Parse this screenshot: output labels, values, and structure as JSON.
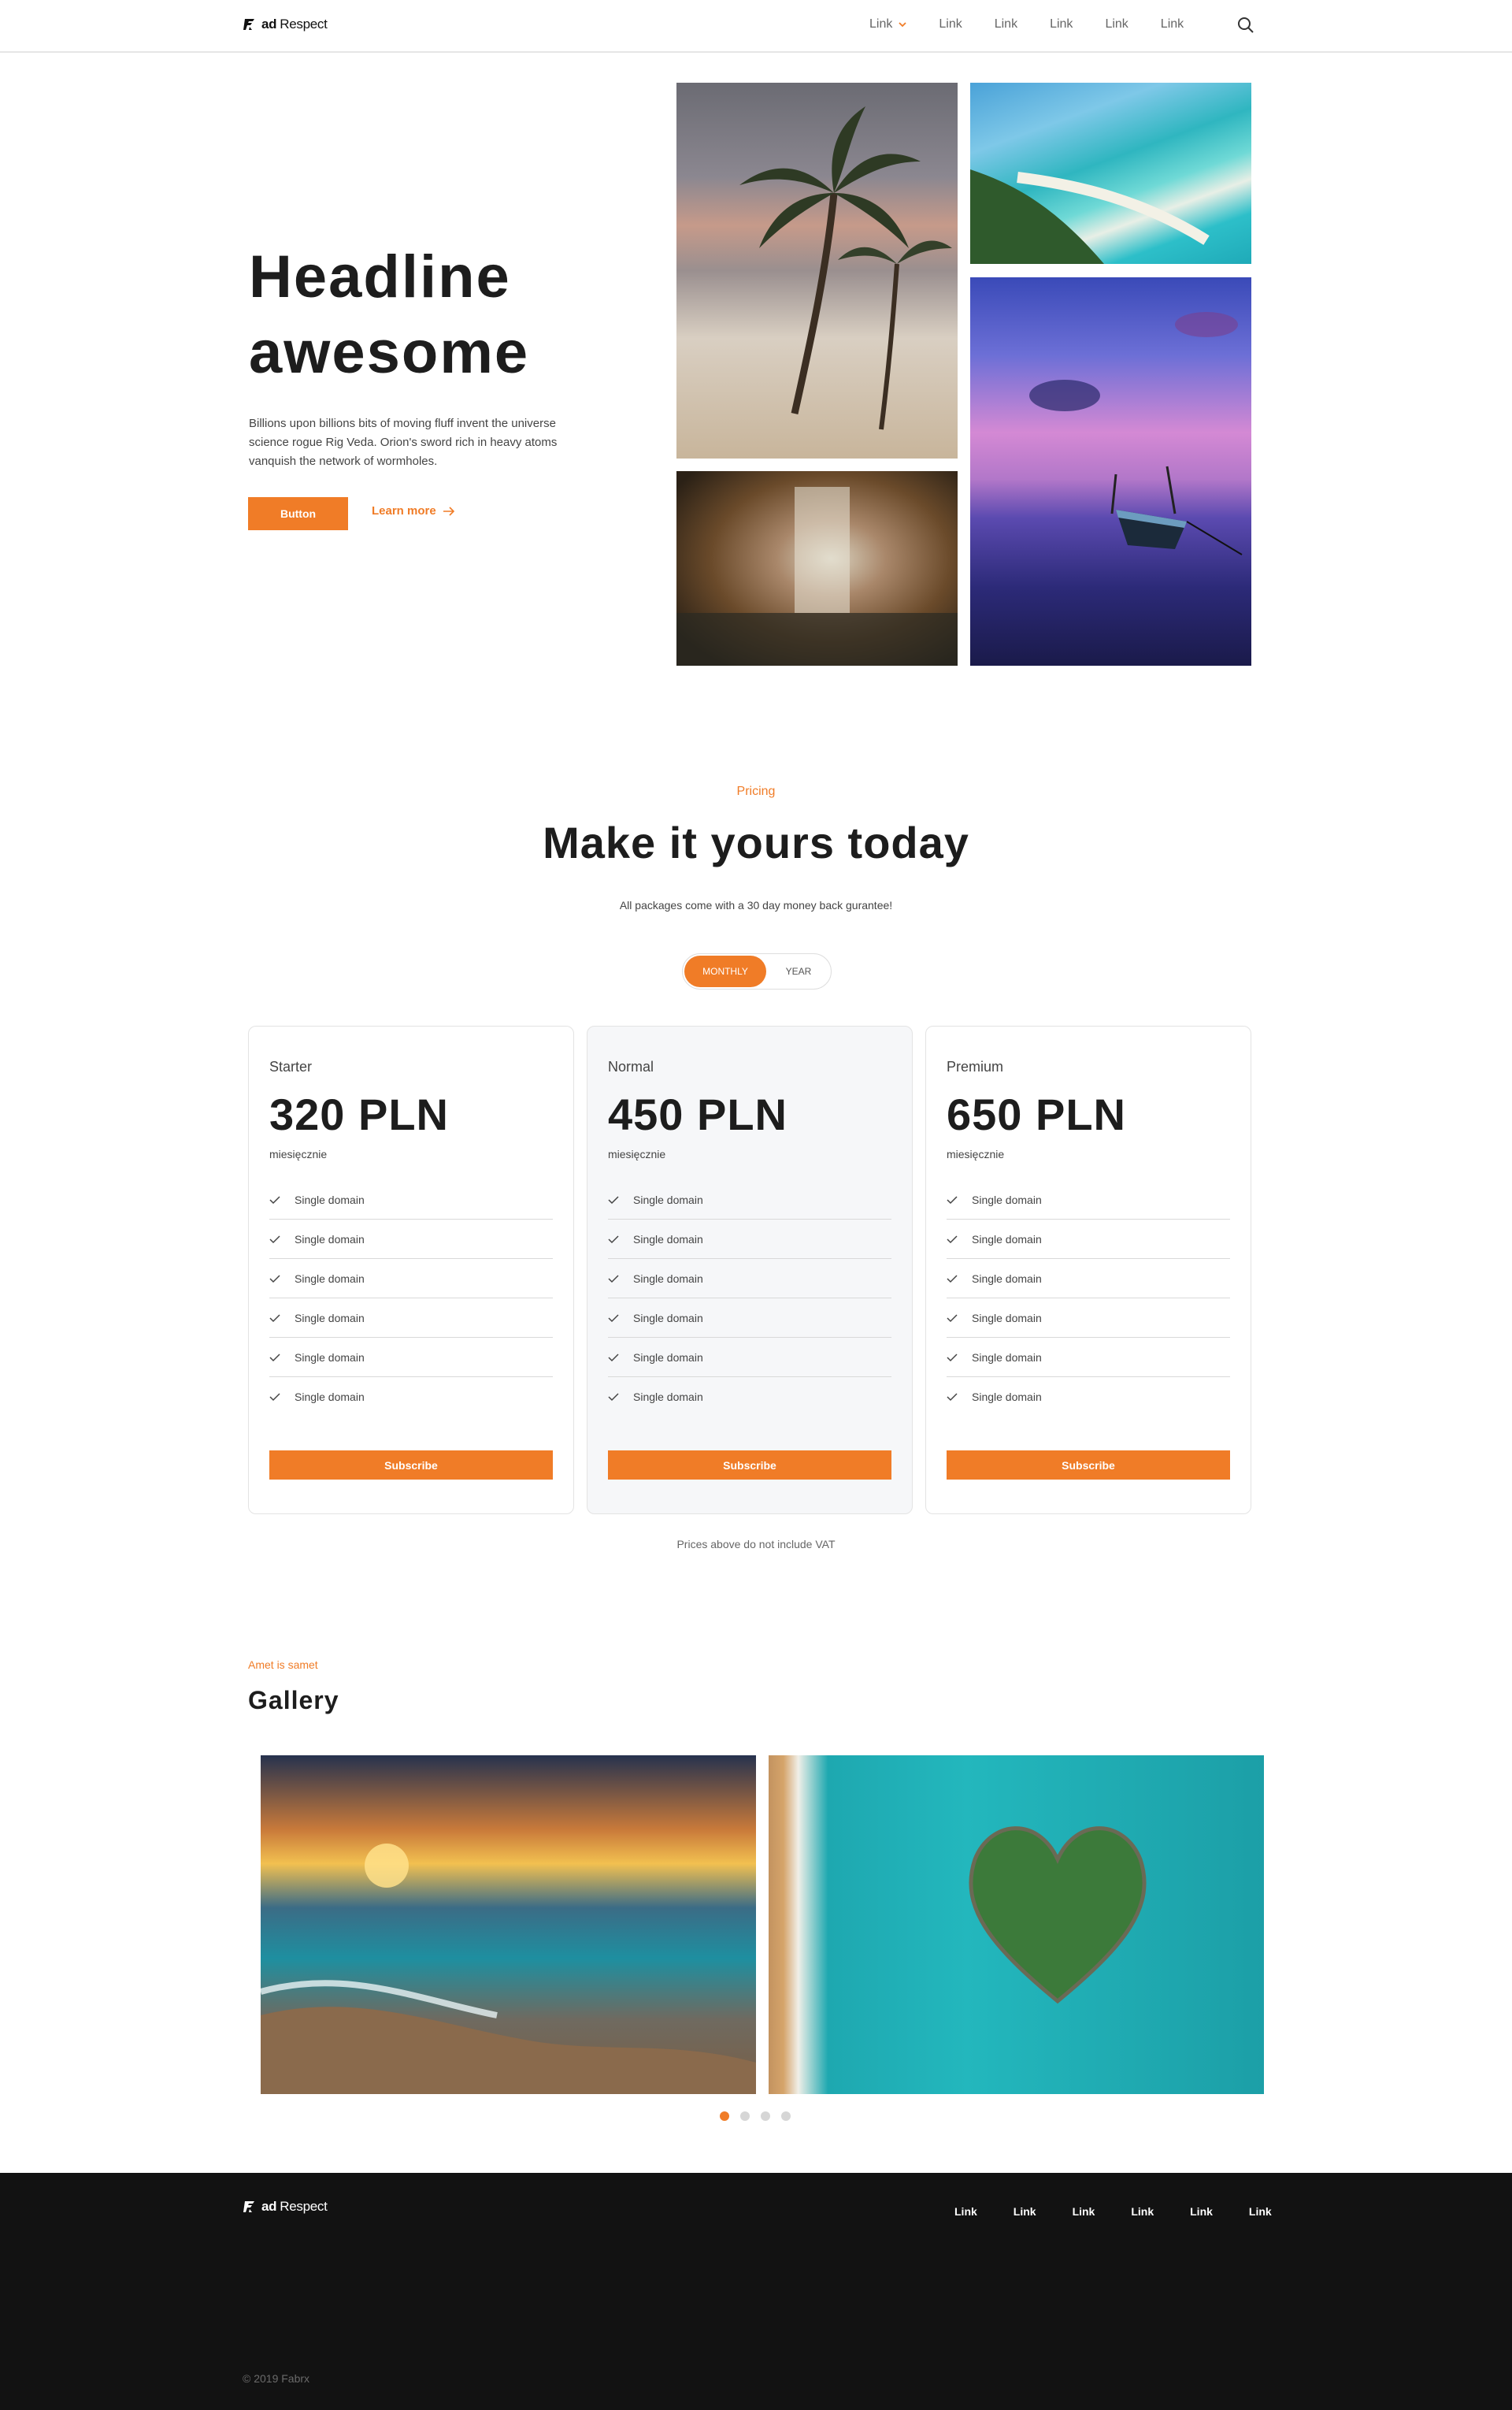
{
  "brand": {
    "logo_bold": "ad",
    "logo_regular": "Respect"
  },
  "nav": {
    "links": [
      "Link",
      "Link",
      "Link",
      "Link",
      "Link",
      "Link"
    ]
  },
  "hero": {
    "title": "Headline awesome",
    "text": "Billions upon billions bits of moving fluff invent the universe science rogue Rig Veda. Orion's sword rich in heavy atoms vanquish the network of wormholes.",
    "button": "Button",
    "learn_more": "Learn more"
  },
  "pricing": {
    "eyebrow": "Pricing",
    "title": "Make it yours today",
    "subtitle": "All packages come with a 30 day money back gurantee!",
    "toggle": {
      "monthly": "MONTHLY",
      "year": "YEAR",
      "selected": "MONTHLY"
    },
    "plans": [
      {
        "name": "Starter",
        "price": "320 PLN",
        "period": "miesięcznie",
        "features": [
          "Single domain",
          "Single domain",
          "Single domain",
          "Single domain",
          "Single domain",
          "Single domain"
        ],
        "cta": "Subscribe"
      },
      {
        "name": "Normal",
        "price": "450 PLN",
        "period": "miesięcznie",
        "features": [
          "Single domain",
          "Single domain",
          "Single domain",
          "Single domain",
          "Single domain",
          "Single domain"
        ],
        "cta": "Subscribe"
      },
      {
        "name": "Premium",
        "price": "650 PLN",
        "period": "miesięcznie",
        "features": [
          "Single domain",
          "Single domain",
          "Single domain",
          "Single domain",
          "Single domain",
          "Single domain"
        ],
        "cta": "Subscribe"
      }
    ],
    "note": "Prices above do not include VAT"
  },
  "gallery": {
    "eyebrow": "Amet is samet",
    "title": "Gallery",
    "active_slide": 1,
    "slide_count": 4
  },
  "footer": {
    "links": [
      "Link",
      "Link",
      "Link",
      "Link",
      "Link",
      "Link"
    ],
    "copyright": "© 2019 Fabrx"
  },
  "colors": {
    "accent": "#f07c27",
    "footer_bg": "#121212",
    "text": "#1d1d1d"
  },
  "icons": {
    "search": "search-icon",
    "check": "check-icon",
    "arrow": "arrow-right-icon",
    "dropdown": "chevron-down-icon"
  }
}
